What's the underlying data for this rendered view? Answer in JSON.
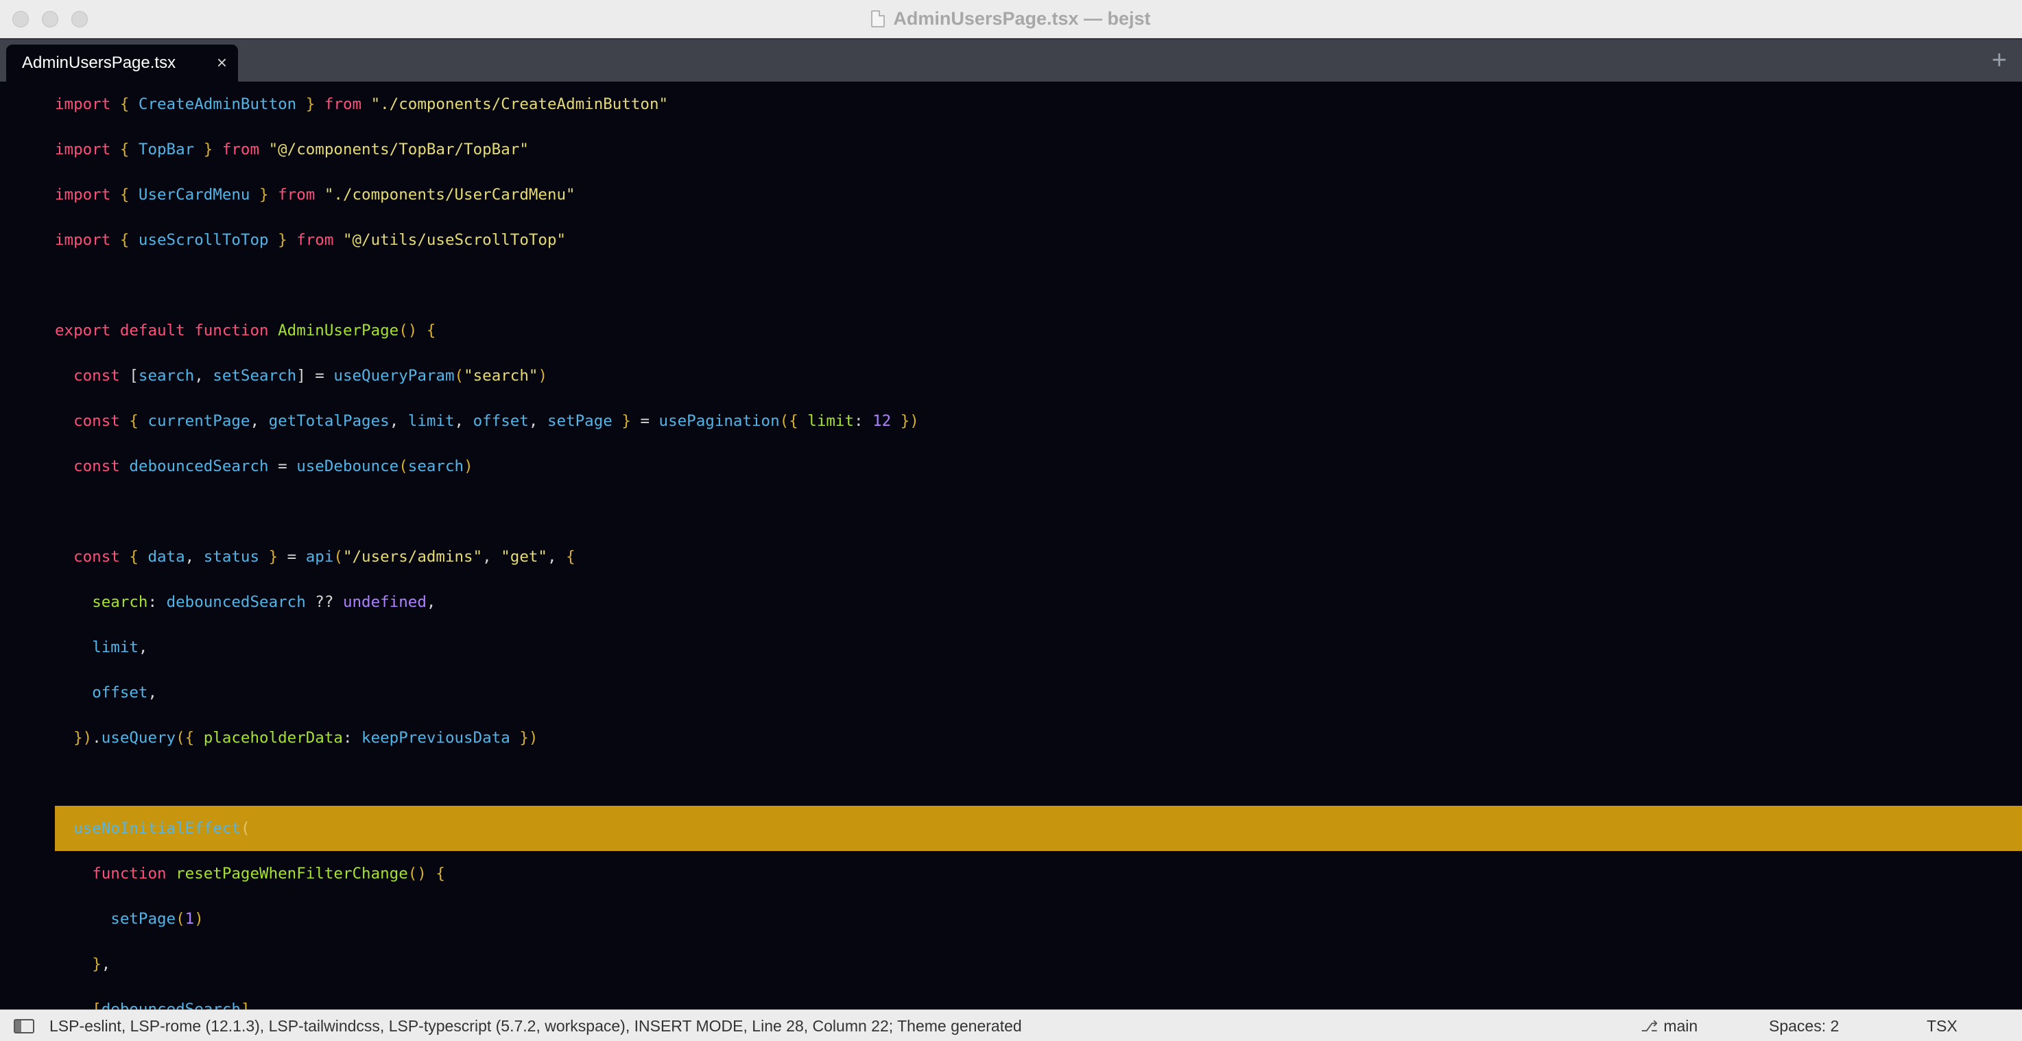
{
  "window": {
    "title": "AdminUsersPage.tsx — bejst"
  },
  "tabs": [
    {
      "label": "AdminUsersPage.tsx",
      "close_glyph": "×"
    }
  ],
  "tab_add_glyph": "+",
  "editor": {
    "current_line_index": 16,
    "lines": [
      [
        [
          "kw",
          "import"
        ],
        [
          "pun",
          " "
        ],
        [
          "br",
          "{"
        ],
        [
          "pun",
          " "
        ],
        [
          "id",
          "CreateAdminButton"
        ],
        [
          "pun",
          " "
        ],
        [
          "br",
          "}"
        ],
        [
          "pun",
          " "
        ],
        [
          "kw",
          "from"
        ],
        [
          "pun",
          " "
        ],
        [
          "str",
          "\"./components/CreateAdminButton\""
        ]
      ],
      [
        [
          "kw",
          "import"
        ],
        [
          "pun",
          " "
        ],
        [
          "br",
          "{"
        ],
        [
          "pun",
          " "
        ],
        [
          "id",
          "TopBar"
        ],
        [
          "pun",
          " "
        ],
        [
          "br",
          "}"
        ],
        [
          "pun",
          " "
        ],
        [
          "kw",
          "from"
        ],
        [
          "pun",
          " "
        ],
        [
          "str",
          "\"@/components/TopBar/TopBar\""
        ]
      ],
      [
        [
          "kw",
          "import"
        ],
        [
          "pun",
          " "
        ],
        [
          "br",
          "{"
        ],
        [
          "pun",
          " "
        ],
        [
          "id",
          "UserCardMenu"
        ],
        [
          "pun",
          " "
        ],
        [
          "br",
          "}"
        ],
        [
          "pun",
          " "
        ],
        [
          "kw",
          "from"
        ],
        [
          "pun",
          " "
        ],
        [
          "str",
          "\"./components/UserCardMenu\""
        ]
      ],
      [
        [
          "kw",
          "import"
        ],
        [
          "pun",
          " "
        ],
        [
          "br",
          "{"
        ],
        [
          "pun",
          " "
        ],
        [
          "id",
          "useScrollToTop"
        ],
        [
          "pun",
          " "
        ],
        [
          "br",
          "}"
        ],
        [
          "pun",
          " "
        ],
        [
          "kw",
          "from"
        ],
        [
          "pun",
          " "
        ],
        [
          "str",
          "\"@/utils/useScrollToTop\""
        ]
      ],
      [],
      [
        [
          "kw",
          "export"
        ],
        [
          "pun",
          " "
        ],
        [
          "kw",
          "default"
        ],
        [
          "pun",
          " "
        ],
        [
          "kw",
          "function"
        ],
        [
          "pun",
          " "
        ],
        [
          "fn",
          "AdminUserPage"
        ],
        [
          "br",
          "()"
        ],
        [
          "pun",
          " "
        ],
        [
          "br",
          "{"
        ]
      ],
      [
        [
          "pun",
          "  "
        ],
        [
          "kw",
          "const"
        ],
        [
          "pun",
          " "
        ],
        [
          "pun",
          "["
        ],
        [
          "id",
          "search"
        ],
        [
          "pun",
          ", "
        ],
        [
          "id",
          "setSearch"
        ],
        [
          "pun",
          "]"
        ],
        [
          "pun",
          " = "
        ],
        [
          "id",
          "useQueryParam"
        ],
        [
          "br",
          "("
        ],
        [
          "str",
          "\"search\""
        ],
        [
          "br",
          ")"
        ]
      ],
      [
        [
          "pun",
          "  "
        ],
        [
          "kw",
          "const"
        ],
        [
          "pun",
          " "
        ],
        [
          "br",
          "{"
        ],
        [
          "pun",
          " "
        ],
        [
          "id",
          "currentPage"
        ],
        [
          "pun",
          ", "
        ],
        [
          "id",
          "getTotalPages"
        ],
        [
          "pun",
          ", "
        ],
        [
          "id",
          "limit"
        ],
        [
          "pun",
          ", "
        ],
        [
          "id",
          "offset"
        ],
        [
          "pun",
          ", "
        ],
        [
          "id",
          "setPage"
        ],
        [
          "pun",
          " "
        ],
        [
          "br",
          "}"
        ],
        [
          "pun",
          " = "
        ],
        [
          "id",
          "usePagination"
        ],
        [
          "br",
          "({"
        ],
        [
          "pun",
          " "
        ],
        [
          "prop",
          "limit"
        ],
        [
          "pun",
          ": "
        ],
        [
          "num",
          "12"
        ],
        [
          "pun",
          " "
        ],
        [
          "br",
          "})"
        ]
      ],
      [
        [
          "pun",
          "  "
        ],
        [
          "kw",
          "const"
        ],
        [
          "pun",
          " "
        ],
        [
          "id",
          "debouncedSearch"
        ],
        [
          "pun",
          " = "
        ],
        [
          "id",
          "useDebounce"
        ],
        [
          "br",
          "("
        ],
        [
          "id",
          "search"
        ],
        [
          "br",
          ")"
        ]
      ],
      [],
      [
        [
          "pun",
          "  "
        ],
        [
          "kw",
          "const"
        ],
        [
          "pun",
          " "
        ],
        [
          "br",
          "{"
        ],
        [
          "pun",
          " "
        ],
        [
          "id",
          "data"
        ],
        [
          "pun",
          ", "
        ],
        [
          "id",
          "status"
        ],
        [
          "pun",
          " "
        ],
        [
          "br",
          "}"
        ],
        [
          "pun",
          " = "
        ],
        [
          "id",
          "api"
        ],
        [
          "br",
          "("
        ],
        [
          "str",
          "\"/users/admins\""
        ],
        [
          "pun",
          ", "
        ],
        [
          "str",
          "\"get\""
        ],
        [
          "pun",
          ", "
        ],
        [
          "br",
          "{"
        ]
      ],
      [
        [
          "pun",
          "    "
        ],
        [
          "prop",
          "search"
        ],
        [
          "pun",
          ": "
        ],
        [
          "id",
          "debouncedSearch"
        ],
        [
          "pun",
          " ?? "
        ],
        [
          "num",
          "undefined"
        ],
        [
          "pun",
          ","
        ]
      ],
      [
        [
          "pun",
          "    "
        ],
        [
          "id",
          "limit"
        ],
        [
          "pun",
          ","
        ]
      ],
      [
        [
          "pun",
          "    "
        ],
        [
          "id",
          "offset"
        ],
        [
          "pun",
          ","
        ]
      ],
      [
        [
          "pun",
          "  "
        ],
        [
          "br",
          "})"
        ],
        [
          "pun",
          "."
        ],
        [
          "id",
          "useQuery"
        ],
        [
          "br",
          "({"
        ],
        [
          "pun",
          " "
        ],
        [
          "prop",
          "placeholderData"
        ],
        [
          "pun",
          ": "
        ],
        [
          "id",
          "keepPreviousData"
        ],
        [
          "pun",
          " "
        ],
        [
          "br",
          "})"
        ]
      ],
      [],
      [
        [
          "pun",
          "  "
        ],
        [
          "cur-text",
          "useNoInitialEffect"
        ],
        [
          "cur-br",
          "("
        ]
      ],
      [
        [
          "pun",
          "    "
        ],
        [
          "kw",
          "function"
        ],
        [
          "pun",
          " "
        ],
        [
          "fn",
          "resetPageWhenFilterChange"
        ],
        [
          "br",
          "()"
        ],
        [
          "pun",
          " "
        ],
        [
          "br",
          "{"
        ]
      ],
      [
        [
          "pun",
          "      "
        ],
        [
          "id",
          "setPage"
        ],
        [
          "br",
          "("
        ],
        [
          "num",
          "1"
        ],
        [
          "br",
          ")"
        ]
      ],
      [
        [
          "pun",
          "    "
        ],
        [
          "br",
          "}"
        ],
        [
          "pun",
          ","
        ]
      ],
      [
        [
          "pun",
          "    "
        ],
        [
          "br",
          "["
        ],
        [
          "id",
          "debouncedSearch"
        ],
        [
          "br",
          "]"
        ]
      ]
    ]
  },
  "statusbar": {
    "text": "LSP-eslint, LSP-rome (12.1.3), LSP-tailwindcss, LSP-typescript (5.7.2, workspace), INSERT MODE, Line 28, Column 22; Theme generated",
    "branch": "main",
    "branch_icon": "git-branch-icon",
    "spaces": "Spaces: 2",
    "syntax": "TSX"
  }
}
